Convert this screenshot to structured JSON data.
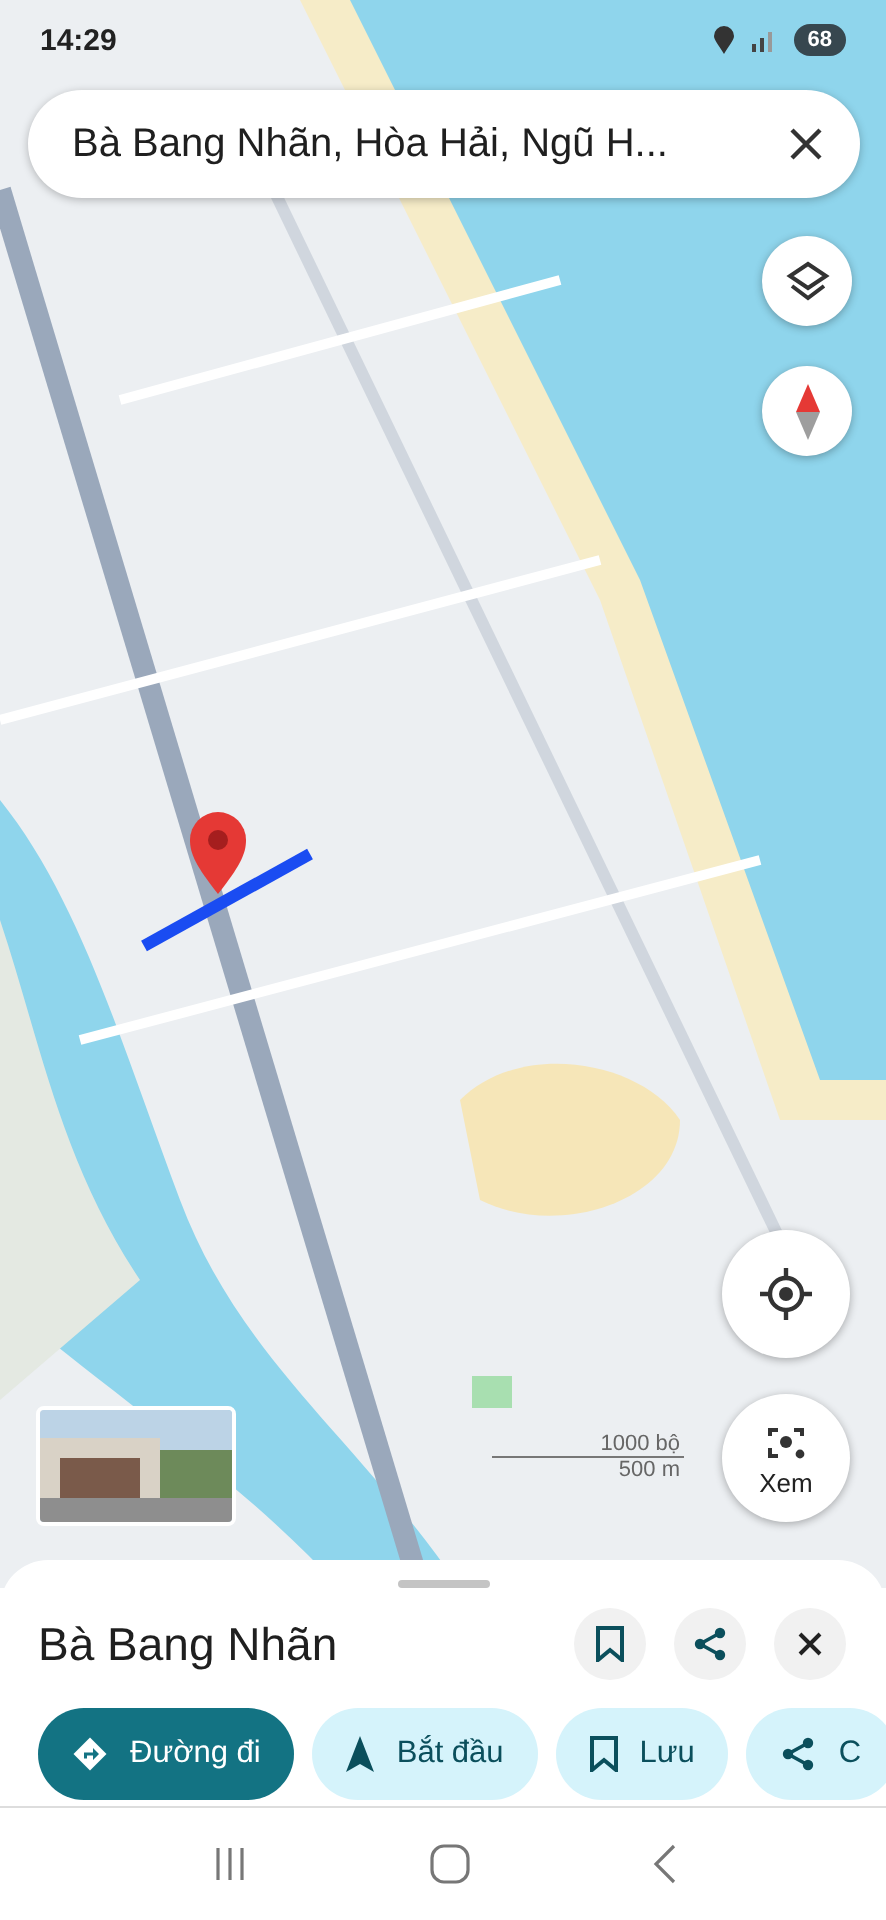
{
  "status_bar": {
    "time": "14:29",
    "battery": "68"
  },
  "search": {
    "value": "Bà Bang Nhãn, Hòa Hải, Ngũ H..."
  },
  "map": {
    "scale": {
      "upper": "1000 bộ",
      "lower": "500 m"
    },
    "lens_button": {
      "label": "Xem"
    }
  },
  "place": {
    "title": "Bà Bang Nhãn"
  },
  "actions": [
    {
      "label": "Đường đi",
      "kind": "directions",
      "primary": true
    },
    {
      "label": "Bắt đầu",
      "kind": "start",
      "primary": false
    },
    {
      "label": "Lưu",
      "kind": "save",
      "primary": false
    },
    {
      "label": "C",
      "kind": "share",
      "primary": false
    }
  ]
}
